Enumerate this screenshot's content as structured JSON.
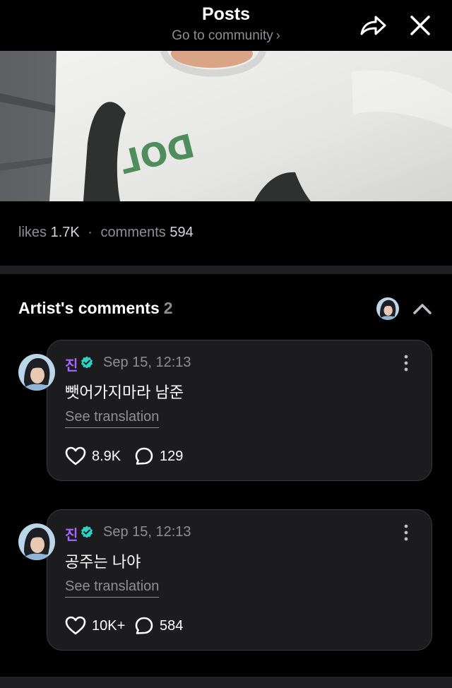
{
  "header": {
    "title": "Posts",
    "subtitle": "Go to community",
    "subtitle_chevron": "›",
    "share_icon": "share-arrow-icon",
    "close_icon": "close-icon"
  },
  "post": {
    "image_description_icon": "post-photo",
    "likes_label": "likes",
    "likes_count": "1.7K",
    "separator": "·",
    "comments_label": "comments",
    "comments_count": "594"
  },
  "artist_comments": {
    "title": "Artist's comments",
    "count": "2",
    "comments": [
      {
        "author": "진",
        "verified_icon": "verified-badge-icon",
        "timestamp": "Sep 15, 12:13",
        "text": "뺏어가지마라 남준",
        "translate_label": "See translation",
        "likes": "8.9K",
        "replies": "129"
      },
      {
        "author": "진",
        "verified_icon": "verified-badge-icon",
        "timestamp": "Sep 15, 12:13",
        "text": "공주는 나야",
        "translate_label": "See translation",
        "likes": "10K+",
        "replies": "584"
      }
    ]
  },
  "colors": {
    "background": "#000000",
    "card": "#1c1c1e",
    "author_purple": "#a565ff",
    "verified_teal": "#2dd4c4",
    "muted": "#8e8e93"
  }
}
